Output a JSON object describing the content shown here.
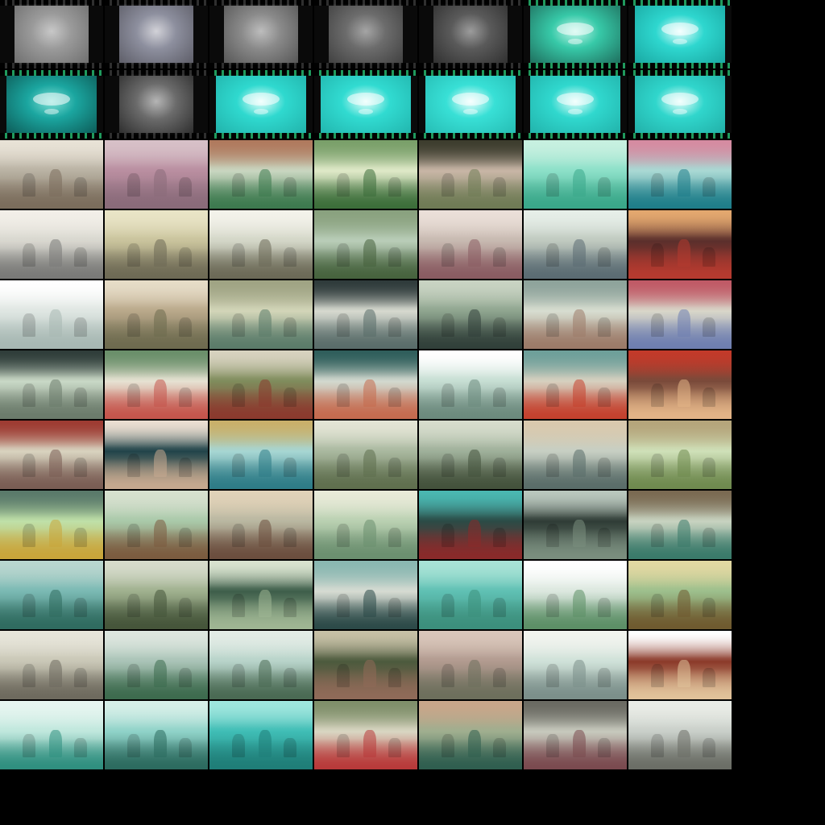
{
  "sheet": {
    "columns": 7,
    "rows": 11,
    "background": "#000000"
  },
  "thumbnails": [
    {
      "id": "r1c1",
      "kind": "film",
      "tone": "gray",
      "colors": [
        "#9a9a9a",
        "#6e6e6e",
        "#c8c8c8"
      ]
    },
    {
      "id": "r1c2",
      "kind": "film",
      "tone": "gray",
      "colors": [
        "#8d8f9e",
        "#5c5c66",
        "#d2d2d8"
      ]
    },
    {
      "id": "r1c3",
      "kind": "film",
      "tone": "gray",
      "colors": [
        "#8a8a8a",
        "#555555",
        "#bdbdbd"
      ]
    },
    {
      "id": "r1c4",
      "kind": "film",
      "tone": "gray",
      "colors": [
        "#6c6c6c",
        "#3f3f3f",
        "#a5a5a5"
      ]
    },
    {
      "id": "r1c5",
      "kind": "film",
      "tone": "gray",
      "colors": [
        "#5a5a5a",
        "#2f2f2f",
        "#9c9c9c"
      ]
    },
    {
      "id": "r1c6",
      "kind": "film",
      "tone": "teal",
      "colors": [
        "#37c9a8",
        "#1f6f5e",
        "#bff6e9"
      ]
    },
    {
      "id": "r1c7",
      "kind": "film",
      "tone": "teal",
      "colors": [
        "#2ed7cf",
        "#1aa8a2",
        "#e9fffd"
      ]
    },
    {
      "id": "r2c1",
      "kind": "film",
      "tone": "teal",
      "colors": [
        "#1ba6a0",
        "#0d5c58",
        "#7fe0d6"
      ]
    },
    {
      "id": "r2c2",
      "kind": "film",
      "tone": "gray",
      "colors": [
        "#6b6b6b",
        "#2c2c2c",
        "#b5b5b5"
      ]
    },
    {
      "id": "r2c3",
      "kind": "film",
      "tone": "teal",
      "colors": [
        "#2fd9cf",
        "#22b3ab",
        "#e6fffb"
      ]
    },
    {
      "id": "r2c4",
      "kind": "film",
      "tone": "teal",
      "colors": [
        "#31dbd1",
        "#22b6ae",
        "#e6fffb"
      ]
    },
    {
      "id": "r2c5",
      "kind": "film",
      "tone": "teal",
      "colors": [
        "#38e0d6",
        "#26bdb4",
        "#eefffd"
      ]
    },
    {
      "id": "r2c6",
      "kind": "film",
      "tone": "teal",
      "colors": [
        "#30d8ce",
        "#22b3ab",
        "#e6fffb"
      ]
    },
    {
      "id": "r2c7",
      "kind": "film",
      "tone": "teal",
      "colors": [
        "#30d6cc",
        "#22b0a8",
        "#e6fffb"
      ]
    },
    {
      "id": "r3c1",
      "kind": "photo",
      "colors": [
        "#b9b2a3",
        "#7b6d5c",
        "#e8e2d6"
      ]
    },
    {
      "id": "r3c2",
      "kind": "photo",
      "colors": [
        "#b98ea0",
        "#8a6b7a",
        "#d7c0c7"
      ]
    },
    {
      "id": "r3c3",
      "kind": "photo",
      "colors": [
        "#c9d6c0",
        "#3d7a4f",
        "#b07a5e"
      ]
    },
    {
      "id": "r3c4",
      "kind": "photo",
      "colors": [
        "#dfe9c8",
        "#3c6e3a",
        "#7aa06a"
      ]
    },
    {
      "id": "r3c5",
      "kind": "photo",
      "colors": [
        "#c8b6a6",
        "#6f7b55",
        "#3d3d2e"
      ]
    },
    {
      "id": "r3c6",
      "kind": "photo",
      "colors": [
        "#8ce0c8",
        "#3aa88a",
        "#c7f0e0"
      ]
    },
    {
      "id": "r3c7",
      "kind": "photo",
      "colors": [
        "#a9d9d4",
        "#1f7e8a",
        "#d58ba1"
      ]
    },
    {
      "id": "r4c1",
      "kind": "photo",
      "colors": [
        "#d8d7cf",
        "#7a7a78",
        "#f2efe8"
      ]
    },
    {
      "id": "r4c2",
      "kind": "photo",
      "colors": [
        "#c9c39c",
        "#6e6a55",
        "#e9e4c6"
      ]
    },
    {
      "id": "r4c3",
      "kind": "photo",
      "colors": [
        "#d3d6c7",
        "#6c6a57",
        "#f3f2ea"
      ]
    },
    {
      "id": "r4c4",
      "kind": "photo",
      "colors": [
        "#b9cdb8",
        "#47633e",
        "#8aa27f"
      ]
    },
    {
      "id": "r4c5",
      "kind": "photo",
      "colors": [
        "#c7b9b0",
        "#8a5c62",
        "#eadfd8"
      ]
    },
    {
      "id": "r4c6",
      "kind": "photo",
      "colors": [
        "#bfc9bf",
        "#5b6c73",
        "#e6eee8"
      ]
    },
    {
      "id": "r4c7",
      "kind": "photo",
      "colors": [
        "#5b2f2c",
        "#b53a2f",
        "#e3a86f"
      ]
    },
    {
      "id": "r5c1",
      "kind": "photo",
      "colors": [
        "#dfe6e2",
        "#a7b8b3",
        "#ffffff"
      ]
    },
    {
      "id": "r5c2",
      "kind": "photo",
      "colors": [
        "#b9a88a",
        "#6e6b4f",
        "#e6dcc7"
      ]
    },
    {
      "id": "r5c3",
      "kind": "photo",
      "colors": [
        "#d2d5b8",
        "#5b7c6a",
        "#a0a484"
      ]
    },
    {
      "id": "r5c4",
      "kind": "photo",
      "colors": [
        "#d6d9cf",
        "#5a6d6a",
        "#2f3b3b"
      ]
    },
    {
      "id": "r5c5",
      "kind": "photo",
      "colors": [
        "#8fa58f",
        "#31403a",
        "#c8d3c2"
      ]
    },
    {
      "id": "r5c6",
      "kind": "photo",
      "colors": [
        "#d7ddd0",
        "#9c7b69",
        "#8ea39b"
      ]
    },
    {
      "id": "r5c7",
      "kind": "photo",
      "colors": [
        "#d8d6c9",
        "#6f7fb0",
        "#c05a66"
      ]
    },
    {
      "id": "r6c1",
      "kind": "photo",
      "colors": [
        "#c9d8c6",
        "#6b7b6b",
        "#2f3d3a"
      ]
    },
    {
      "id": "r6c2",
      "kind": "photo",
      "colors": [
        "#e6e2d2",
        "#c5554c",
        "#6a8f6a"
      ]
    },
    {
      "id": "r6c3",
      "kind": "photo",
      "colors": [
        "#7f8c5c",
        "#8b3a2e",
        "#d7d2bf"
      ]
    },
    {
      "id": "r6c4",
      "kind": "photo",
      "colors": [
        "#d2d9cf",
        "#c56b4f",
        "#2f5e5b"
      ]
    },
    {
      "id": "r6c5",
      "kind": "photo",
      "colors": [
        "#c6ded3",
        "#6c8a7d",
        "#ffffff"
      ]
    },
    {
      "id": "r6c6",
      "kind": "photo",
      "colors": [
        "#d6d0bf",
        "#c4412e",
        "#6e9f9a"
      ]
    },
    {
      "id": "r6c7",
      "kind": "photo",
      "colors": [
        "#7a4a3a",
        "#e3b487",
        "#c23a2a"
      ]
    },
    {
      "id": "r7c1",
      "kind": "photo",
      "colors": [
        "#d8d3bf",
        "#7a5d54",
        "#9d3b32"
      ]
    },
    {
      "id": "r7c2",
      "kind": "photo",
      "colors": [
        "#21444a",
        "#c6a98f",
        "#eaded1"
      ]
    },
    {
      "id": "r7c3",
      "kind": "photo",
      "colors": [
        "#a7d6d3",
        "#2e7c87",
        "#c9b06a"
      ]
    },
    {
      "id": "r7c4",
      "kind": "photo",
      "colors": [
        "#a9b89f",
        "#5f6f4e",
        "#e3e4d5"
      ]
    },
    {
      "id": "r7c5",
      "kind": "photo",
      "colors": [
        "#9fb09a",
        "#44523c",
        "#d6dccc"
      ]
    },
    {
      "id": "r7c6",
      "kind": "photo",
      "colors": [
        "#c7cfc3",
        "#5a6d69",
        "#d9c9ae"
      ]
    },
    {
      "id": "r7c7",
      "kind": "photo",
      "colors": [
        "#cfe0b8",
        "#6f8a4f",
        "#b5a57b"
      ]
    },
    {
      "id": "r8c1",
      "kind": "photo",
      "colors": [
        "#bfe0a8",
        "#c9a53a",
        "#5a7a6a"
      ]
    },
    {
      "id": "r8c2",
      "kind": "photo",
      "colors": [
        "#a9c9a9",
        "#7b5b3f",
        "#d7e0cf"
      ]
    },
    {
      "id": "r8c3",
      "kind": "photo",
      "colors": [
        "#b9b7a1",
        "#6b4e3e",
        "#e1d2b8"
      ]
    },
    {
      "id": "r8c4",
      "kind": "photo",
      "colors": [
        "#b9d0b1",
        "#6b8f6f",
        "#e8ead8"
      ]
    },
    {
      "id": "r8c5",
      "kind": "photo",
      "colors": [
        "#2b4b46",
        "#8a2a2a",
        "#4ab7b1"
      ]
    },
    {
      "id": "r8c6",
      "kind": "photo",
      "colors": [
        "#2f3c36",
        "#7a8e7e",
        "#b9c7bd"
      ]
    },
    {
      "id": "r8c7",
      "kind": "photo",
      "colors": [
        "#c8d3c0",
        "#3a7a6a",
        "#7a6a52"
      ]
    },
    {
      "id": "r9c1",
      "kind": "photo",
      "colors": [
        "#7ab9b3",
        "#2f6b5f",
        "#b9d6cf"
      ]
    },
    {
      "id": "r9c2",
      "kind": "photo",
      "colors": [
        "#9fb08e",
        "#45553a",
        "#d6dbcb"
      ]
    },
    {
      "id": "r9c3",
      "kind": "photo",
      "colors": [
        "#3e5e4a",
        "#9fb693",
        "#d9e3cf"
      ]
    },
    {
      "id": "r9c4",
      "kind": "photo",
      "colors": [
        "#d6dbd2",
        "#2c4a48",
        "#8ab7b1"
      ]
    },
    {
      "id": "r9c5",
      "kind": "photo",
      "colors": [
        "#5fc0b3",
        "#3c8f7c",
        "#a8e3d6"
      ]
    },
    {
      "id": "r9c6",
      "kind": "photo",
      "colors": [
        "#dbe7de",
        "#5c8f66",
        "#ffffff"
      ]
    },
    {
      "id": "r9c7",
      "kind": "photo",
      "colors": [
        "#9cbf8c",
        "#6f5a2f",
        "#e2d8a2"
      ]
    },
    {
      "id": "r10c1",
      "kind": "photo",
      "colors": [
        "#c9c7b6",
        "#6e6a5e",
        "#e7e5da"
      ]
    },
    {
      "id": "r10c2",
      "kind": "photo",
      "colors": [
        "#a9c3b6",
        "#3d6b4e",
        "#dde6df"
      ]
    },
    {
      "id": "r10c3",
      "kind": "photo",
      "colors": [
        "#b7d3c9",
        "#4a6a53",
        "#e3ece6"
      ]
    },
    {
      "id": "r10c4",
      "kind": "photo",
      "colors": [
        "#4c5a3d",
        "#8f6a58",
        "#c7c0a6"
      ]
    },
    {
      "id": "r10c5",
      "kind": "photo",
      "colors": [
        "#b19a8f",
        "#6d6f5c",
        "#d9c6ba"
      ]
    },
    {
      "id": "r10c6",
      "kind": "photo",
      "colors": [
        "#cfe1d8",
        "#7b8f8a",
        "#f2f4ef"
      ]
    },
    {
      "id": "r10c7",
      "kind": "photo",
      "colors": [
        "#8b3a2a",
        "#e0c29a",
        "#ffffff"
      ]
    },
    {
      "id": "r11c1",
      "kind": "photo",
      "colors": [
        "#bfe7dc",
        "#2f8f7f",
        "#e6f5f0"
      ]
    },
    {
      "id": "r11c2",
      "kind": "photo",
      "colors": [
        "#8fd2c8",
        "#2c6b5f",
        "#d6efe8"
      ]
    },
    {
      "id": "r11c3",
      "kind": "photo",
      "colors": [
        "#3fbdb5",
        "#1f7e78",
        "#9fe6de"
      ]
    },
    {
      "id": "r11c4",
      "kind": "photo",
      "colors": [
        "#d9d6c2",
        "#b83a3a",
        "#7f8f6a"
      ]
    },
    {
      "id": "r11c5",
      "kind": "photo",
      "colors": [
        "#9fae8f",
        "#2f5e4f",
        "#c8a68a"
      ]
    },
    {
      "id": "r11c6",
      "kind": "photo",
      "colors": [
        "#c7c9bd",
        "#7a4a4f",
        "#6a6a62"
      ]
    },
    {
      "id": "r11c7",
      "kind": "photo",
      "colors": [
        "#c9cfc9",
        "#6b6e66",
        "#e9ece6"
      ]
    }
  ]
}
